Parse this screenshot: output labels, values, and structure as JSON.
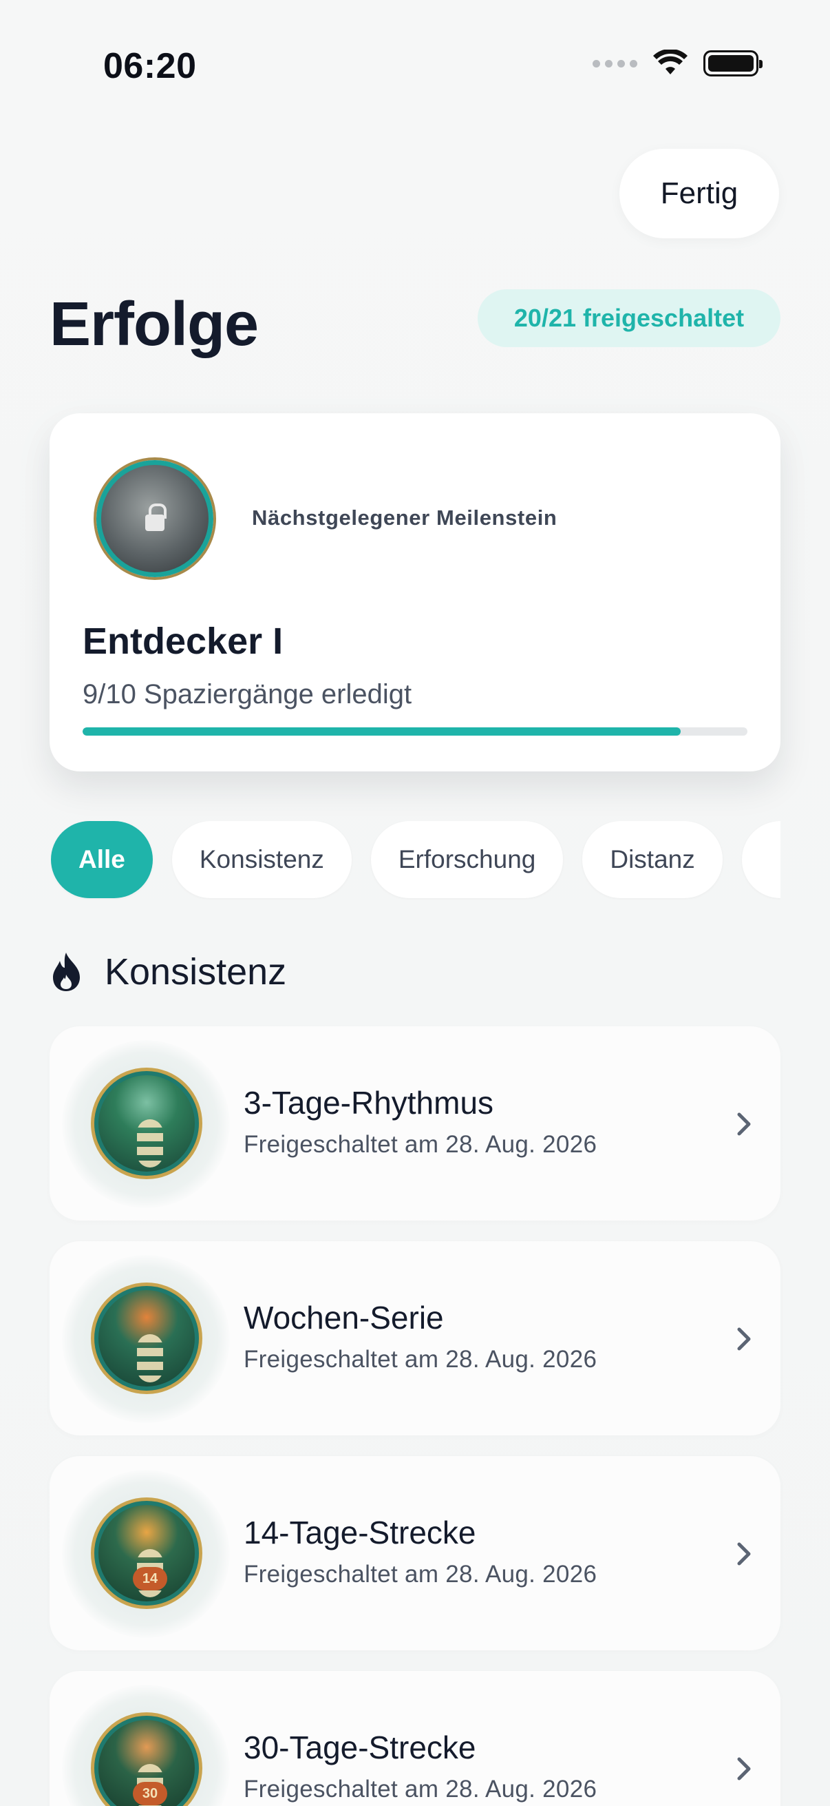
{
  "status": {
    "time": "06:20"
  },
  "header": {
    "done_label": "Fertig",
    "title": "Erfolge",
    "unlocked_badge": "20/21 freigeschaltet"
  },
  "milestone": {
    "label": "Nächstgelegener Meilenstein",
    "name": "Entdecker I",
    "progress_text": "9/10 Spaziergänge erledigt",
    "progress_fraction": 0.9
  },
  "filters": {
    "items": [
      "Alle",
      "Konsistenz",
      "Erforschung",
      "Distanz"
    ],
    "selected": "Alle"
  },
  "section": {
    "title": "Konsistenz",
    "icon": "flame-icon"
  },
  "achievements": [
    {
      "title": "3-Tage-Rhythmus",
      "date": "Freigeschaltet am 28. Aug. 2026",
      "palette": [
        "#2e7d5a",
        "#173f33",
        "#7cc0a3"
      ]
    },
    {
      "title": "Wochen-Serie",
      "date": "Freigeschaltet am 28. Aug. 2026",
      "palette": [
        "#2a6f54",
        "#143a2e",
        "#e2833b"
      ]
    },
    {
      "title": "14-Tage-Strecke",
      "date": "Freigeschaltet am 28. Aug. 2026",
      "palette": [
        "#2d6a4c",
        "#13392b",
        "#e8a545"
      ],
      "badge": "14"
    },
    {
      "title": "30-Tage-Strecke",
      "date": "Freigeschaltet am 28. Aug. 2026",
      "palette": [
        "#2b6347",
        "#133528",
        "#e29a55"
      ],
      "badge": "30"
    }
  ],
  "colors": {
    "accent": "#1fb4aa",
    "title": "#141b2c",
    "muted": "#4b5362"
  }
}
